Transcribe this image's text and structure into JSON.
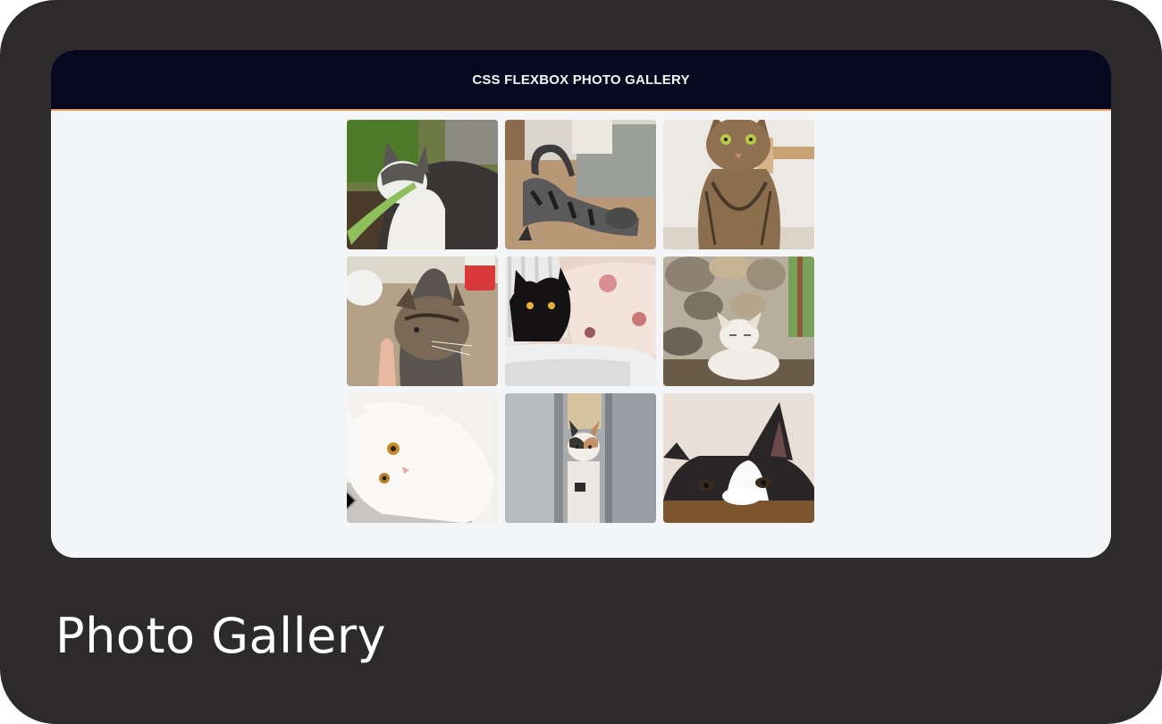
{
  "header": {
    "title": "CSS FLEXBOX PHOTO GALLERY"
  },
  "gallery": {
    "photos": [
      {
        "subject": "white and grey cat sniffing leaf",
        "icon": "photo-icon"
      },
      {
        "subject": "grey tabby cat stretching on floor",
        "icon": "photo-icon"
      },
      {
        "subject": "brown tabby cat sitting",
        "icon": "photo-icon"
      },
      {
        "subject": "tabby cat sniffing finger",
        "icon": "photo-icon"
      },
      {
        "subject": "black cat in laundry basket",
        "icon": "photo-icon"
      },
      {
        "subject": "light cat on stone wall",
        "icon": "photo-icon"
      },
      {
        "subject": "white fluffy cat lying",
        "icon": "photo-icon"
      },
      {
        "subject": "calico cat peeking through door",
        "icon": "photo-icon"
      },
      {
        "subject": "black and white cat peeking over edge",
        "icon": "photo-icon"
      }
    ]
  },
  "footer": {
    "caption": "Photo Gallery"
  },
  "colors": {
    "frame": "#2c2a2b",
    "header_bg": "#080820",
    "accent_line": "#e8a060",
    "page_bg": "#f4f5f7"
  }
}
